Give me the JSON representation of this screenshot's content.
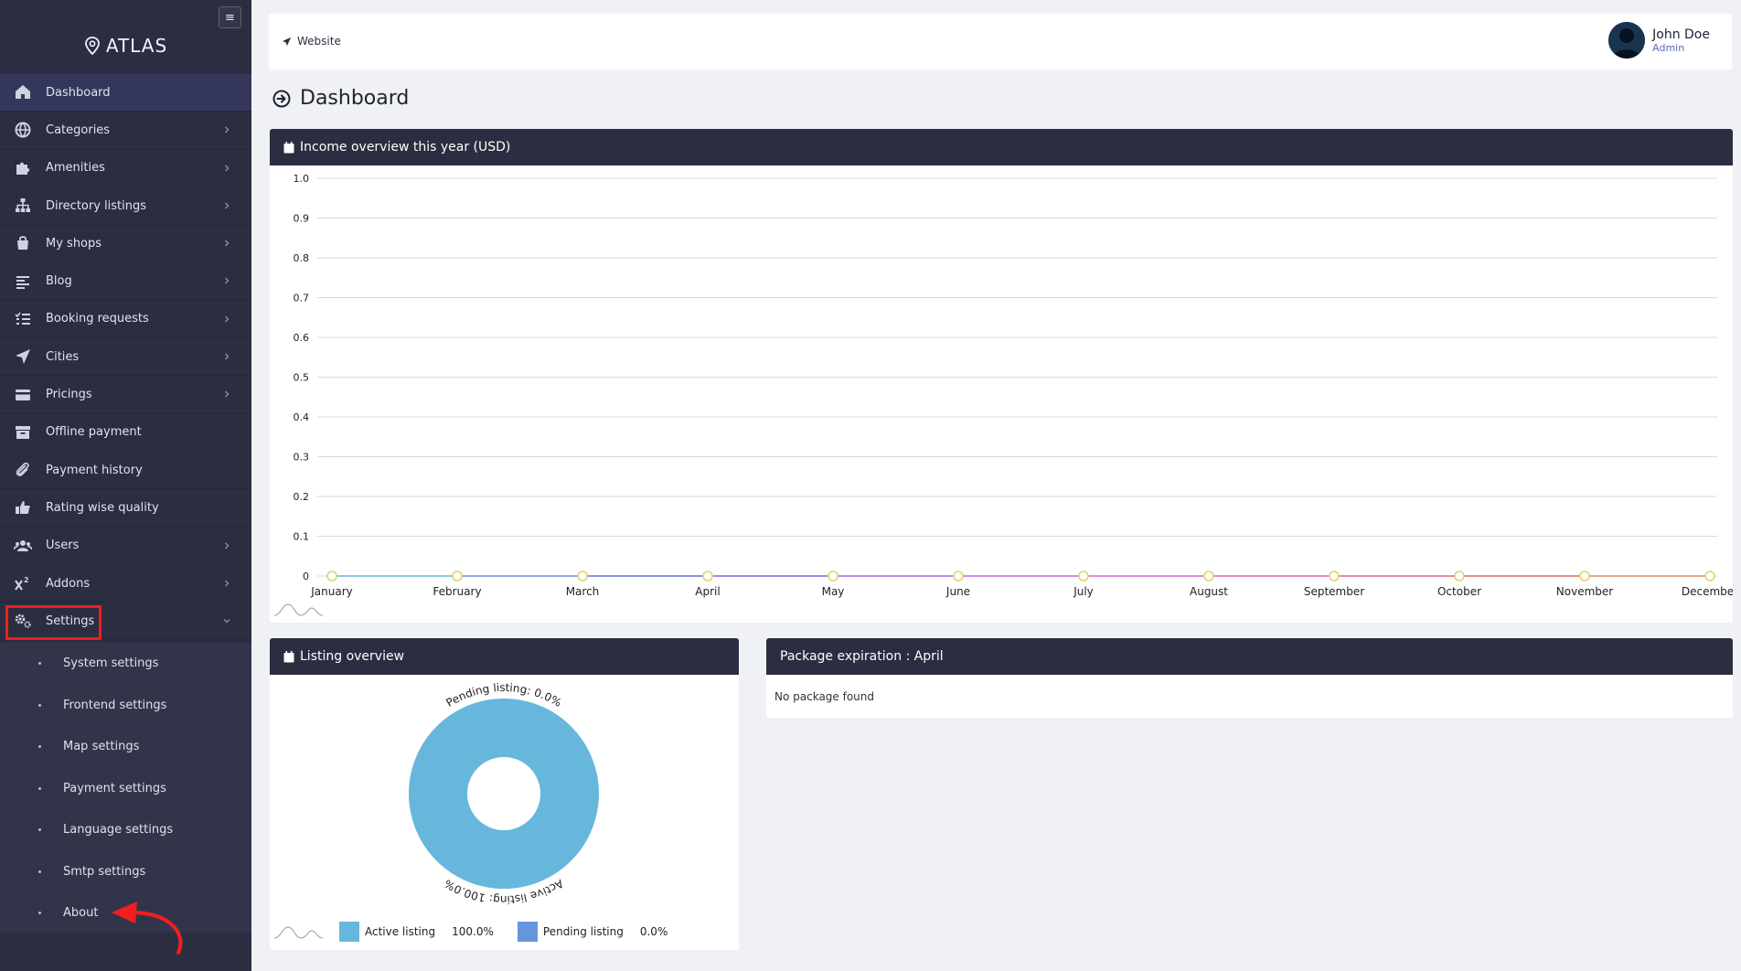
{
  "brand": {
    "name": "ATLAS"
  },
  "sidebar": {
    "items": [
      {
        "label": "Dashboard",
        "icon": "home-icon",
        "has_children": false,
        "active": true
      },
      {
        "label": "Categories",
        "icon": "globe-icon",
        "has_children": true
      },
      {
        "label": "Amenities",
        "icon": "puzzle-icon",
        "has_children": true
      },
      {
        "label": "Directory listings",
        "icon": "sitemap-icon",
        "has_children": true
      },
      {
        "label": "My shops",
        "icon": "shopping-bag-icon",
        "has_children": true
      },
      {
        "label": "Blog",
        "icon": "align-left-icon",
        "has_children": true
      },
      {
        "label": "Booking requests",
        "icon": "list-check-icon",
        "has_children": true
      },
      {
        "label": "Cities",
        "icon": "location-arrow-icon",
        "has_children": true
      },
      {
        "label": "Pricings",
        "icon": "credit-card-icon",
        "has_children": true
      },
      {
        "label": "Offline payment",
        "icon": "archive-icon",
        "has_children": false
      },
      {
        "label": "Payment history",
        "icon": "paperclip-icon",
        "has_children": false
      },
      {
        "label": "Rating wise quality",
        "icon": "thumbs-up-icon",
        "has_children": false
      },
      {
        "label": "Users",
        "icon": "users-icon",
        "has_children": true
      },
      {
        "label": "Addons",
        "icon": "superscript-icon",
        "has_children": true
      },
      {
        "label": "Settings",
        "icon": "cogs-icon",
        "has_children": true,
        "expanded": true
      }
    ],
    "settings_children": [
      "System settings",
      "Frontend settings",
      "Map settings",
      "Payment settings",
      "Language settings",
      "Smtp settings",
      "About"
    ]
  },
  "topbar": {
    "website_label": "Website",
    "user_name": "John Doe",
    "user_role": "Admin"
  },
  "page": {
    "title": "Dashboard"
  },
  "income_card": {
    "title": "Income overview this year (USD)"
  },
  "listing_card": {
    "title": "Listing overview"
  },
  "package_card": {
    "title": "Package expiration : April",
    "body": "No package found"
  },
  "colors": {
    "sidebar_bg": "#2b2e40",
    "annotation_red": "#f21e1e",
    "active_slice": "#67b7dc",
    "pending_slice": "#6794dc"
  },
  "chart_data": [
    {
      "type": "line",
      "title": "Income overview this year (USD)",
      "categories": [
        "January",
        "February",
        "March",
        "April",
        "May",
        "June",
        "July",
        "August",
        "September",
        "October",
        "November",
        "December"
      ],
      "values": [
        0,
        0,
        0,
        0,
        0,
        0,
        0,
        0,
        0,
        0,
        0,
        0
      ],
      "ylim": [
        0,
        1.0
      ],
      "yticks": [
        "0",
        "0.1",
        "0.2",
        "0.3",
        "0.4",
        "0.5",
        "0.6",
        "0.7",
        "0.8",
        "0.9",
        "1.0"
      ],
      "grid": true
    },
    {
      "type": "pie",
      "title": "Listing overview",
      "slices": [
        {
          "name": "Active listing",
          "value": 100.0,
          "label": "Active listing: 100.0%",
          "display": "100.0%"
        },
        {
          "name": "Pending listing",
          "value": 0.0,
          "label": "Pending listing: 0.0%",
          "display": "0.0%"
        }
      ],
      "legend": "bottom"
    }
  ]
}
